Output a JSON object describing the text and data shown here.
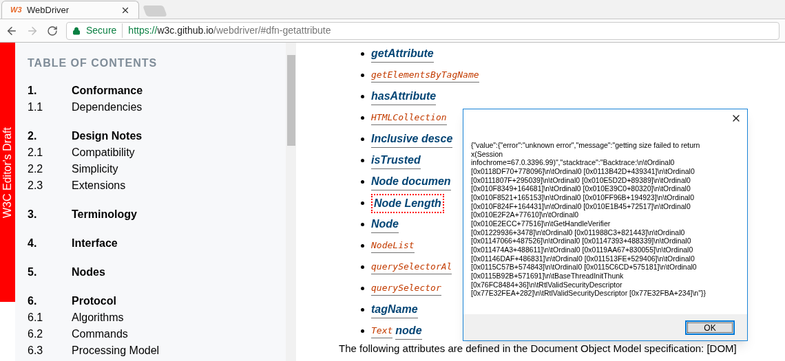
{
  "browser": {
    "tab": {
      "title": "WebDriver",
      "logo": "W3",
      "selected": true
    },
    "address": {
      "secure_label": "Secure",
      "url_scheme": "https://",
      "url_host": "w3c.github.io",
      "url_path": "/webdriver/#dfn-getattribute"
    }
  },
  "sidebar": {
    "status_label": "W3C Editor's Draft"
  },
  "toc": {
    "heading": "TABLE OF CONTENTS",
    "entries": [
      {
        "number": "1.",
        "title": "Conformance",
        "kind": "section"
      },
      {
        "number": "1.1",
        "title": "Dependencies",
        "kind": "subsection"
      },
      {
        "number": "2.",
        "title": "Design Notes",
        "kind": "section"
      },
      {
        "number": "2.1",
        "title": "Compatibility",
        "kind": "subsection"
      },
      {
        "number": "2.2",
        "title": "Simplicity",
        "kind": "subsection"
      },
      {
        "number": "2.3",
        "title": "Extensions",
        "kind": "subsection"
      },
      {
        "number": "3.",
        "title": "Terminology",
        "kind": "section"
      },
      {
        "number": "4.",
        "title": "Interface",
        "kind": "section"
      },
      {
        "number": "5.",
        "title": "Nodes",
        "kind": "section"
      },
      {
        "number": "6.",
        "title": "Protocol",
        "kind": "section"
      },
      {
        "number": "6.1",
        "title": "Algorithms",
        "kind": "subsection"
      },
      {
        "number": "6.2",
        "title": "Commands",
        "kind": "subsection"
      },
      {
        "number": "6.3",
        "title": "Processing Model",
        "kind": "subsection"
      }
    ]
  },
  "content": {
    "items": [
      {
        "parts": [
          {
            "text": "getAttribute",
            "kind": "dfn"
          }
        ],
        "focused": false
      },
      {
        "parts": [
          {
            "text": "getElementsByTagName",
            "kind": "code"
          }
        ],
        "focused": false
      },
      {
        "parts": [
          {
            "text": "hasAttribute",
            "kind": "dfn"
          }
        ],
        "focused": false
      },
      {
        "parts": [
          {
            "text": "HTMLCollection",
            "kind": "code"
          }
        ],
        "focused": false
      },
      {
        "parts": [
          {
            "text": "Inclusive desce",
            "kind": "dfn"
          }
        ],
        "focused": false
      },
      {
        "parts": [
          {
            "text": "isTrusted",
            "kind": "dfn"
          }
        ],
        "focused": false
      },
      {
        "parts": [
          {
            "text": "Node documen",
            "kind": "dfn"
          }
        ],
        "focused": false
      },
      {
        "parts": [
          {
            "text": "Node Length",
            "kind": "dfn"
          }
        ],
        "focused": true
      },
      {
        "parts": [
          {
            "text": "Node",
            "kind": "dfn"
          }
        ],
        "focused": false
      },
      {
        "parts": [
          {
            "text": "NodeList",
            "kind": "code"
          }
        ],
        "focused": false
      },
      {
        "parts": [
          {
            "text": "querySelectorAl",
            "kind": "code"
          }
        ],
        "focused": false
      },
      {
        "parts": [
          {
            "text": "querySelector",
            "kind": "code"
          }
        ],
        "focused": false
      },
      {
        "parts": [
          {
            "text": "tagName",
            "kind": "dfn"
          }
        ],
        "focused": false
      },
      {
        "parts": [
          {
            "text": "Text",
            "kind": "code"
          },
          {
            "text": "node",
            "kind": "dfn"
          }
        ],
        "focused": false
      }
    ],
    "paragraph": "The following attributes are defined in the Document Object Model specification: [DOM]"
  },
  "dialog": {
    "message": "{\"value\":{\"error\":\"unknown error\",\"message\":\"getting size failed to return\nx(Session\ninfochrome=67.0.3396.99)\",\"stacktrace\":\"Backtrace:\\n\\tOrdinal0\n[0x0118DF70+778096]\\n\\tOrdinal0 [0x0113B42D+439341]\\n\\tOrdinal0\n[0x0111807F+295039]\\n\\tOrdinal0 [0x010E5D2D+89389]\\n\\tOrdinal0\n[0x010F8349+164681]\\n\\tOrdinal0 [0x010E39C0+80320]\\n\\tOrdinal0\n[0x010F8521+165153]\\n\\tOrdinal0 [0x010FF96B+194923]\\n\\tOrdinal0\n[0x010F824F+164431]\\n\\tOrdinal0 [0x010E1B45+72517]\\n\\tOrdinal0\n[0x010E2F2A+77610]\\n\\tOrdinal0\n[0x010E2ECC+77516]\\n\\tGetHandleVerifier\n[0x01229936+3478]\\n\\tOrdinal0 [0x011988C3+821443]\\n\\tOrdinal0\n[0x01147066+487526]\\n\\tOrdinal0 [0x01147393+488339]\\n\\tOrdinal0\n[0x011474A3+488611]\\n\\tOrdinal0 [0x0119AA67+830055]\\n\\tOrdinal0\n[0x01146DAF+486831]\\n\\tOrdinal0 [0x011513FE+529406]\\n\\tOrdinal0\n[0x0115C57B+574843]\\n\\tOrdinal0 [0x0115C6CD+575181]\\n\\tOrdinal0\n[0x0115B92B+571691]\\n\\tBaseThreadInitThunk\n[0x76FC8484+36]\\n\\tRtlValidSecurityDescriptor\n[0x77E32FEA+282]\\n\\tRtlValidSecurityDescriptor [0x77E32FBA+234]\\n\"}}",
    "button": "OK"
  }
}
